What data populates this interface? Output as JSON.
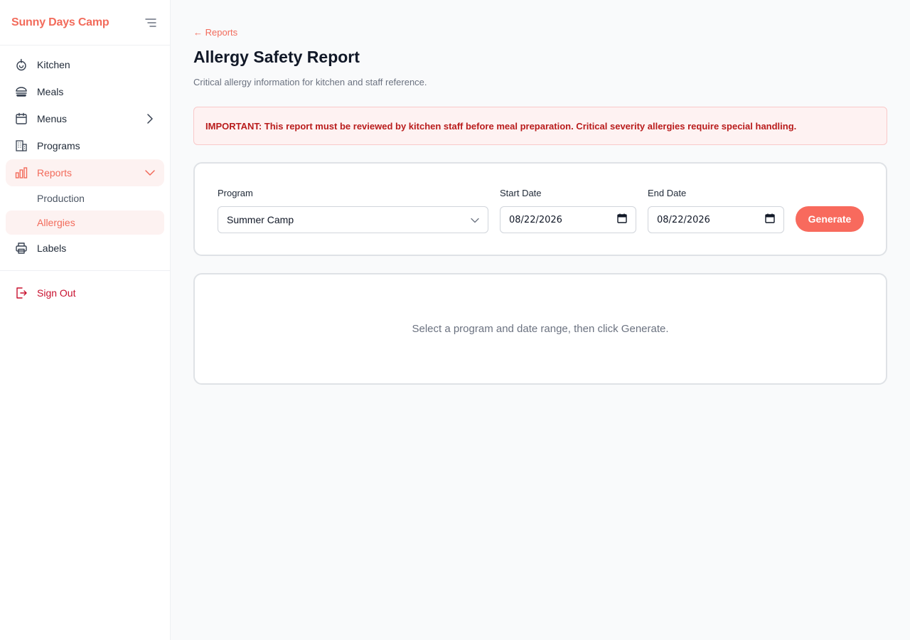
{
  "sidebar": {
    "brand": "Sunny Days Camp",
    "items": [
      {
        "label": "Kitchen",
        "icon": "kitchen-icon"
      },
      {
        "label": "Meals",
        "icon": "meals-icon"
      },
      {
        "label": "Menus",
        "icon": "calendar-icon"
      },
      {
        "label": "Programs",
        "icon": "building-icon"
      },
      {
        "label": "Reports",
        "icon": "bar-chart-icon"
      }
    ],
    "sub_items": [
      {
        "label": "Production"
      },
      {
        "label": "Allergies"
      }
    ],
    "labels_item": {
      "label": "Labels",
      "icon": "printer-icon"
    },
    "sign_out": "Sign Out"
  },
  "header": {
    "back_link": "← Reports",
    "title": "Allergy Safety Report",
    "subtitle": "Critical allergy information for kitchen and staff reference."
  },
  "alert": {
    "text": "IMPORTANT: This report must be reviewed by kitchen staff before meal preparation. Critical severity allergies require special handling."
  },
  "filters": {
    "program_label": "Program",
    "program_value": "Summer Camp",
    "start_label": "Start Date",
    "start_value": "08/22/2026",
    "end_label": "End Date",
    "end_value": "08/22/2026",
    "generate_label": "Generate"
  },
  "results": {
    "empty_text": "Select a program and date range, then click Generate."
  },
  "colors": {
    "accent": "#f26b5b",
    "danger": "#c8102e",
    "alert_bg": "#fef2f2"
  }
}
